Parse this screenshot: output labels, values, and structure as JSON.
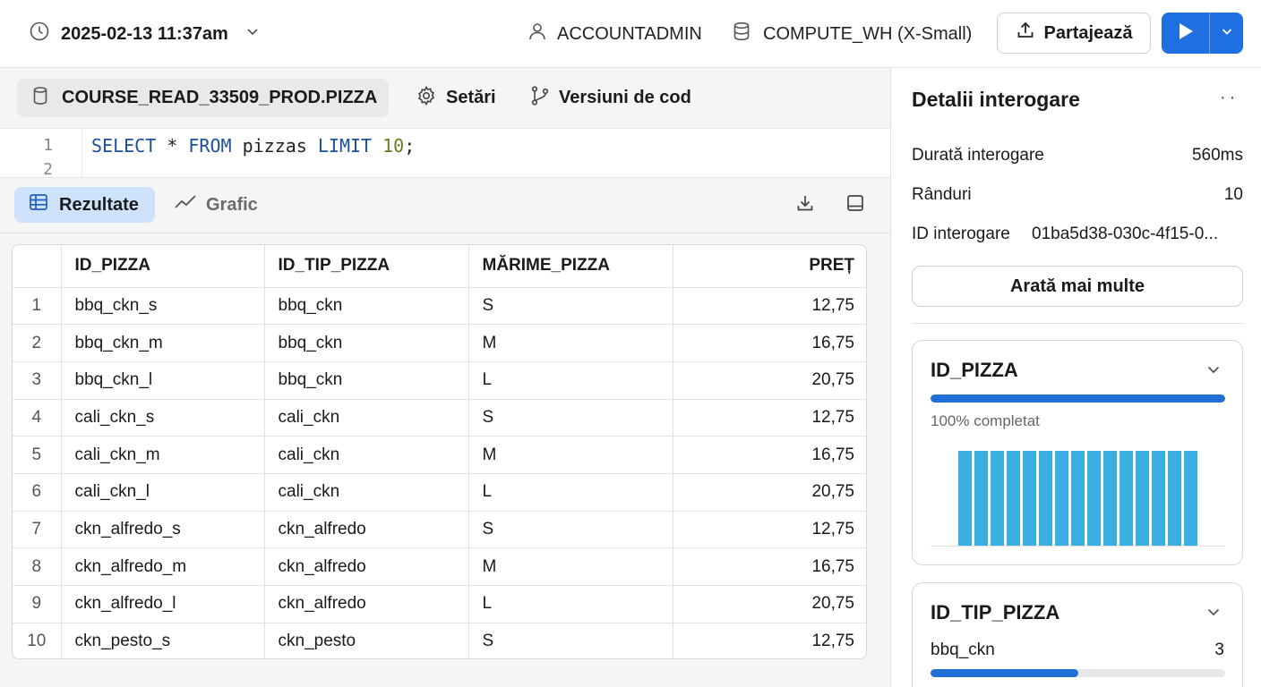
{
  "topbar": {
    "timestamp": "2025-02-13 11:37am",
    "user": "ACCOUNTADMIN",
    "warehouse": "COMPUTE_WH (X-Small)",
    "share_label": "Partajează",
    "accent": "#1f6fe0"
  },
  "editor": {
    "database": "COURSE_READ_33509_PROD.PIZZA",
    "settings_label": "Setări",
    "versions_label": "Versiuni de cod",
    "line_numbers": [
      "1",
      "2"
    ],
    "code": {
      "kw_select": "SELECT",
      "star": " * ",
      "kw_from": "FROM",
      "table": " pizzas ",
      "kw_limit": "LIMIT",
      "limit_value": " 10",
      "semicolon": ";"
    }
  },
  "results": {
    "results_tab": "Rezultate",
    "chart_tab": "Grafic",
    "columns": [
      "",
      "ID_PIZZA",
      "ID_TIP_PIZZA",
      "MĂRIME_PIZZA",
      "PREȚ"
    ],
    "rows": [
      [
        "1",
        "bbq_ckn_s",
        "bbq_ckn",
        "S",
        "12,75"
      ],
      [
        "2",
        "bbq_ckn_m",
        "bbq_ckn",
        "M",
        "16,75"
      ],
      [
        "3",
        "bbq_ckn_l",
        "bbq_ckn",
        "L",
        "20,75"
      ],
      [
        "4",
        "cali_ckn_s",
        "cali_ckn",
        "S",
        "12,75"
      ],
      [
        "5",
        "cali_ckn_m",
        "cali_ckn",
        "M",
        "16,75"
      ],
      [
        "6",
        "cali_ckn_l",
        "cali_ckn",
        "L",
        "20,75"
      ],
      [
        "7",
        "ckn_alfredo_s",
        "ckn_alfredo",
        "S",
        "12,75"
      ],
      [
        "8",
        "ckn_alfredo_m",
        "ckn_alfredo",
        "M",
        "16,75"
      ],
      [
        "9",
        "ckn_alfredo_l",
        "ckn_alfredo",
        "L",
        "20,75"
      ],
      [
        "10",
        "ckn_pesto_s",
        "ckn_pesto",
        "S",
        "12,75"
      ]
    ]
  },
  "details": {
    "title": "Detalii interogare",
    "menu": "··",
    "duration_label": "Durată interogare",
    "duration_value": "560ms",
    "rows_label": "Rânduri",
    "rows_value": "10",
    "id_label": "ID interogare",
    "id_value": "01ba5d38-030c-4f15-0...",
    "show_more": "Arată mai multe",
    "card1": {
      "title": "ID_PIZZA",
      "progress": 1.0,
      "subtitle": "100% completat",
      "histogram": [
        1,
        1,
        1,
        1,
        1,
        1,
        1,
        1,
        1,
        1,
        1,
        1,
        1,
        1,
        1
      ],
      "histogram_color": "#3ab0e2"
    },
    "card2": {
      "title": "ID_TIP_PIZZA",
      "top_value_label": "bbq_ckn",
      "top_value_count": "3",
      "top_value_fraction": 0.5
    }
  }
}
